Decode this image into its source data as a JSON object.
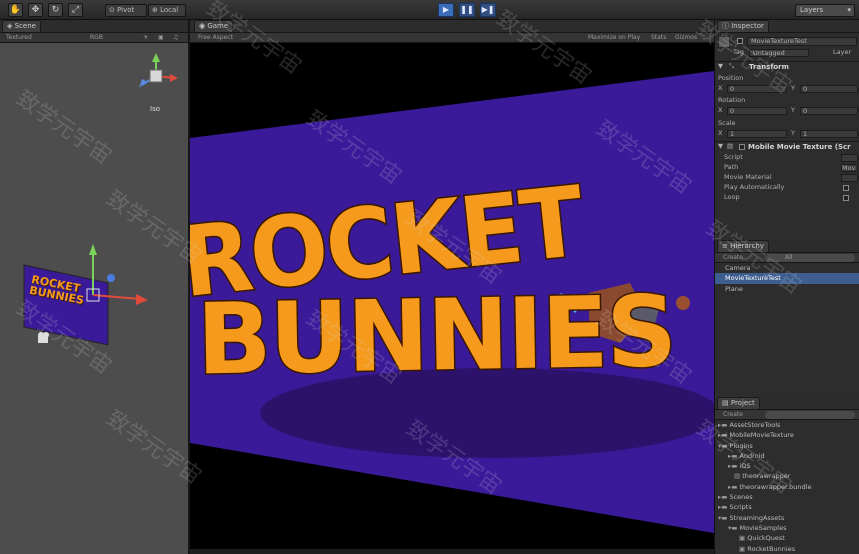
{
  "toolbar": {
    "pivot_label": "Pivot",
    "local_label": "Local",
    "layers_label": "Layers"
  },
  "scene": {
    "tab_label": "Scene",
    "textured_label": "Textured",
    "rgb_label": "RGB",
    "iso_label": "Iso",
    "poster_line1": "ROCKET",
    "poster_line2": "BUNNIES"
  },
  "game": {
    "tab_label": "Game",
    "aspect_label": "Free Aspect",
    "maximize_label": "Maximize on Play",
    "stats_label": "Stats",
    "gizmos_label": "Gizmos",
    "title_line1": "ROCKET",
    "title_line2": "BUNNIES"
  },
  "inspector": {
    "tab_label": "Inspector",
    "object_name": "MovieTextureTest",
    "tag_label": "Tag",
    "tag_value": "Untagged",
    "layer_label": "Layer",
    "transform_label": "Transform",
    "position_label": "Position",
    "rotation_label": "Rotation",
    "scale_label": "Scale",
    "x_label": "X",
    "y_label": "Y",
    "pos_x": "0",
    "pos_y": "0",
    "rot_x": "0",
    "rot_y": "0",
    "scale_x": "1",
    "scale_y": "1",
    "component_label": "Mobile Movie Texture (Scr",
    "script_label": "Script",
    "path_label": "Path",
    "movie_material_label": "Movie Material",
    "play_auto_label": "Play Automatically",
    "loop_label": "Loop",
    "path_value": "Mov"
  },
  "hierarchy": {
    "tab_label": "Hierarchy",
    "create_label": "Create",
    "search_placeholder": "All",
    "items": [
      "Camera",
      "MovieTextureTest",
      "Plane"
    ]
  },
  "project": {
    "tab_label": "Project",
    "create_label": "Create",
    "items": [
      "AssetStoreTools",
      "MobileMovieTexture",
      "Plugins",
      "Android",
      "iOS",
      "theorawrapper",
      "theorawrapper.bundle",
      "Scenes",
      "Scripts",
      "StreamingAssets",
      "MovieSamples",
      "QuickQuest",
      "RocketBunnies"
    ]
  },
  "watermark": "致学元宇宙",
  "colors": {
    "accent": "#3b6db8",
    "poster_bg": "#3b1a9a",
    "title_orange": "#f59a1c"
  }
}
